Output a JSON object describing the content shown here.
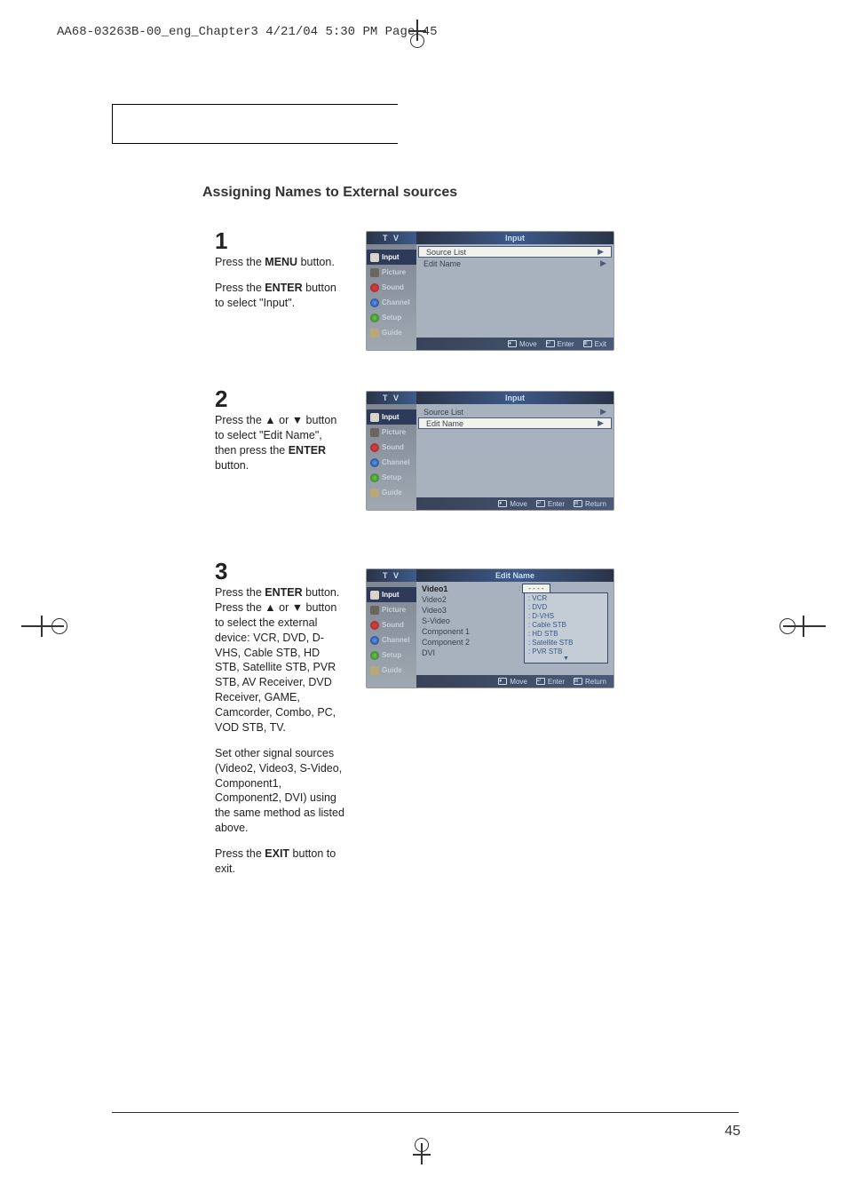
{
  "header": "AA68-03263B-00_eng_Chapter3  4/21/04  5:30 PM  Page 45",
  "section_title": "Assigning Names to External sources",
  "page_number": "45",
  "steps": {
    "s1": {
      "num": "1",
      "p1a": "Press the ",
      "p1b": "MENU",
      "p1c": " button.",
      "p2a": "Press the ",
      "p2b": "ENTER",
      "p2c": " button to select \"Input\"."
    },
    "s2": {
      "num": "2",
      "p1a": "Press the ▲ or ▼ button to select \"Edit Name\", then press the ",
      "p1b": "ENTER",
      "p1c": " button."
    },
    "s3": {
      "num": "3",
      "p1a": "Press the ",
      "p1b": "ENTER",
      "p1c": " button. Press the ▲ or ▼ button to select the external device: VCR, DVD, D-VHS, Cable STB, HD STB, Satellite STB, PVR STB, AV Receiver, DVD Receiver, GAME, Camcorder, Combo, PC, VOD STB, TV.",
      "p2": "Set other signal sources (Video2, Video3, S-Video, Component1, Component2, DVI) using the same method as listed above.",
      "p3a": "Press the ",
      "p3b": "EXIT",
      "p3c": " button to exit."
    }
  },
  "osd": {
    "tv": "T V",
    "sidebar": {
      "input": "Input",
      "picture": "Picture",
      "sound": "Sound",
      "channel": "Channel",
      "setup": "Setup",
      "guide": "Guide"
    },
    "panel1": {
      "title": "Input",
      "r1": "Source List",
      "r2": "Edit Name",
      "footer": {
        "move": "Move",
        "enter": "Enter",
        "exit": "Exit"
      }
    },
    "panel2": {
      "title": "Input",
      "r1": "Source List",
      "r2": "Edit Name",
      "footer": {
        "move": "Move",
        "enter": "Enter",
        "return": "Return"
      }
    },
    "panel3": {
      "title": "Edit Name",
      "left": {
        "r1": "Video1",
        "r2": "Video2",
        "r3": "Video3",
        "r4": "S-Video",
        "r5": "Component 1",
        "r6": "Component 2",
        "r7": "DVI"
      },
      "dash": "- - - -",
      "dropdown": {
        "d1": "VCR",
        "d2": "DVD",
        "d3": "D-VHS",
        "d4": "Cable STB",
        "d5": "HD STB",
        "d6": "Satellite STB",
        "d7": "PVR STB"
      },
      "footer": {
        "move": "Move",
        "enter": "Enter",
        "return": "Return"
      }
    }
  }
}
